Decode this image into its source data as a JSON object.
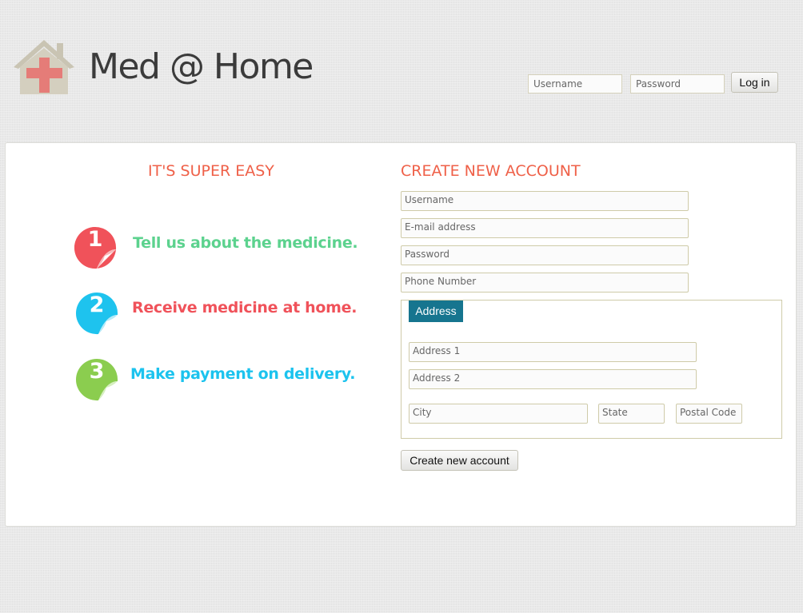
{
  "header": {
    "title": "Med @ Home",
    "logo_icon": "house-medical-cross-icon"
  },
  "login": {
    "username_placeholder": "Username",
    "password_placeholder": "Password",
    "login_label": "Log in"
  },
  "steps_section": {
    "heading": "IT'S SUPER EASY",
    "steps": [
      {
        "number": "1",
        "text": "Tell us about the medicine.",
        "badge_color": "#f0525a",
        "text_color": "#5cd28e"
      },
      {
        "number": "2",
        "text": "Receive medicine at home.",
        "badge_color": "#1ec3ee",
        "text_color": "#f0525a"
      },
      {
        "number": "3",
        "text": "Make payment on delivery.",
        "badge_color": "#8bcd4f",
        "text_color": "#1cc3ee"
      }
    ]
  },
  "signup": {
    "heading": "CREATE NEW ACCOUNT",
    "username_placeholder": "Username",
    "email_placeholder": "E-mail address",
    "password_placeholder": "Password",
    "phone_placeholder": "Phone Number",
    "address": {
      "legend": "Address",
      "address1_placeholder": "Address 1",
      "address2_placeholder": "Address 2",
      "city_placeholder": "City",
      "state_placeholder": "State",
      "postal_placeholder": "Postal Code"
    },
    "submit_label": "Create new account"
  },
  "colors": {
    "heading": "#ef6048",
    "legend_bg": "#16758f",
    "title_text": "#3b3b3b"
  }
}
